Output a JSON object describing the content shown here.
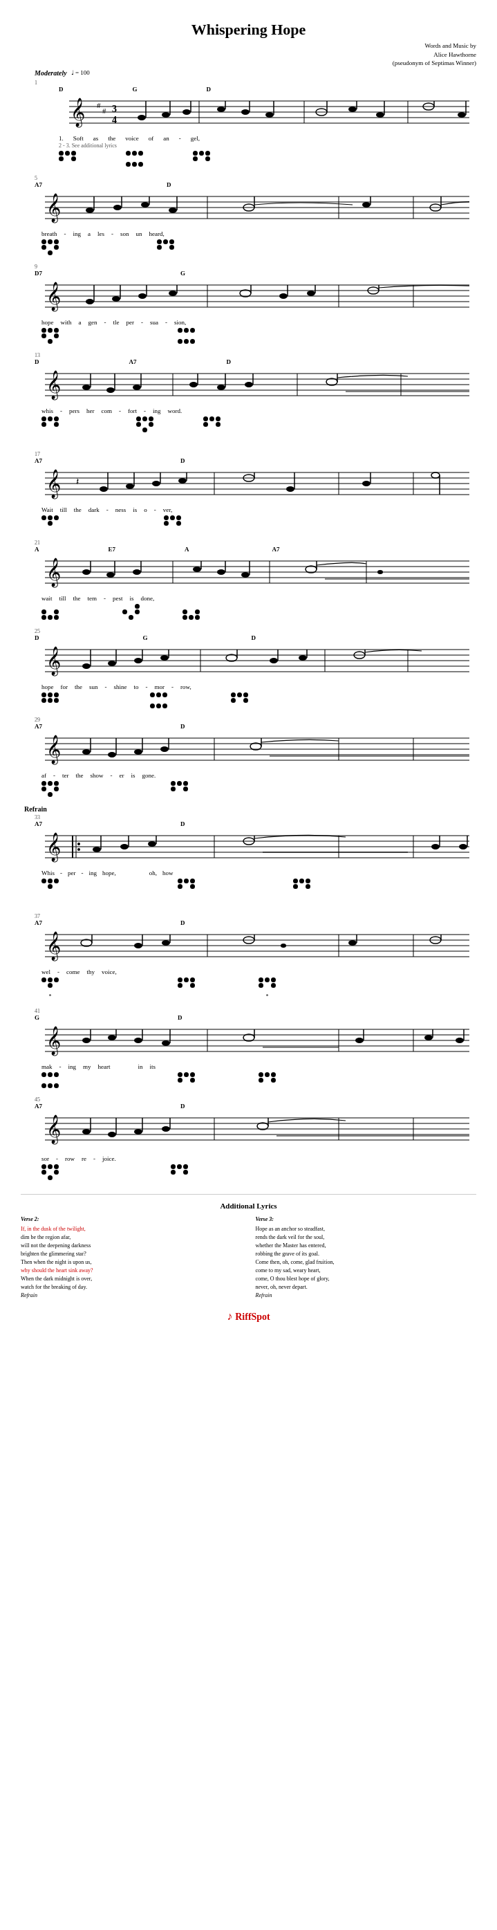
{
  "title": "Whispering Hope",
  "attribution": {
    "line1": "Words and Music by",
    "line2": "Alice Hawthorne",
    "line3": "(pseudonym of Septimas Winner)"
  },
  "tempo": {
    "marking": "Moderately",
    "bpm": "♩ = 100"
  },
  "additional_lyrics": {
    "title": "Additional Lyrics",
    "verse2": {
      "title": "Verse 2:",
      "text": "If, in the dusk of the twilight,\ndim be the region afar,\nwill not the deepening darkness\nbrighten the glimmering star?\nThen when the night is upon us,\nwhy should the heart sink away?\nWhen the dark midnight is over,\nwatch for the breaking of day.",
      "refrain": "Refrain"
    },
    "verse3": {
      "title": "Verse 3:",
      "text": "Hope as an anchor so steadfast,\nrends the dark veil for the soul,\nwhether the Master has entered,\nrobbing the grave of its goal.\nCome then, oh, come, glad fruition,\ncome to my sad, weary heart,\ncome, O thou blest hope of glory,\nnever, oh, never depart.",
      "refrain": "Refrain"
    }
  },
  "branding": {
    "name": "RiffSpot",
    "symbol": "♪"
  },
  "staff_sections": [
    {
      "measure_range": "1",
      "chords": [
        "D",
        "",
        "G",
        "",
        "D"
      ],
      "lyrics": "1.  Soft    as    the    voice    of    an    -    gel,",
      "section": ""
    },
    {
      "measure_range": "5",
      "chords": [
        "A7",
        "",
        "D"
      ],
      "lyrics": "breath  -  ing    a    les  -  son    un  -  heard,",
      "section": ""
    },
    {
      "measure_range": "9",
      "chords": [
        "D7",
        "",
        "G"
      ],
      "lyrics": "hope    with    a    gen  -  tle    per  -  sua  -  sion,",
      "section": ""
    },
    {
      "measure_range": "13",
      "chords": [
        "D",
        "",
        "A7",
        "",
        "D"
      ],
      "lyrics": "whis  -  pers    her    com  -  fort  -  ing    word.",
      "section": ""
    },
    {
      "measure_range": "17",
      "chords": [
        "A7",
        "",
        "D"
      ],
      "lyrics": "Wait    till    the    dark  -  ness    is    o  -  ver,",
      "section": ""
    },
    {
      "measure_range": "21",
      "chords": [
        "A",
        "",
        "E7",
        "",
        "A",
        "",
        "A7"
      ],
      "lyrics": "wait    till    the    tem  -  pest    is    done,",
      "section": ""
    },
    {
      "measure_range": "25",
      "chords": [
        "D",
        "",
        "G",
        "",
        "D"
      ],
      "lyrics": "hope    for    the    sun  -  shine    to  -  mor  -  row,",
      "section": ""
    },
    {
      "measure_range": "29",
      "chords": [
        "A7",
        "",
        "D"
      ],
      "lyrics": "af  -  ter    the    show  -  er    is    gone.",
      "section": ""
    },
    {
      "measure_range": "33",
      "chords": [
        "A7",
        "",
        "D"
      ],
      "lyrics": "Whis  -  per  -  ing    hope,              oh,    how",
      "section": "Refrain"
    },
    {
      "measure_range": "37",
      "chords": [
        "A7",
        "",
        "D"
      ],
      "lyrics": "wel  -  come    thy    voice,",
      "section": ""
    },
    {
      "measure_range": "41",
      "chords": [
        "G",
        "",
        "D"
      ],
      "lyrics": "mak  -  ing    my    heart              in    its",
      "section": ""
    },
    {
      "measure_range": "45",
      "chords": [
        "A7",
        "",
        "D"
      ],
      "lyrics": "sor  -  row    re  -  joice.",
      "section": ""
    }
  ]
}
